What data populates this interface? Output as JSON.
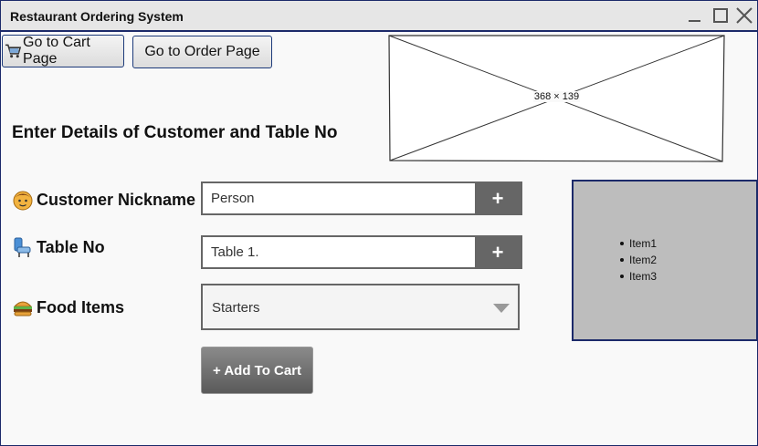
{
  "window": {
    "title": "Restaurant Ordering System"
  },
  "toolbar": {
    "cart_button_label": "Go to Cart Page",
    "order_button_label": "Go to Order Page"
  },
  "image_placeholder": {
    "label": "368 × 139"
  },
  "form": {
    "heading": "Enter Details of Customer and Table No",
    "nickname": {
      "label": "Customer Nickname",
      "value": "Person",
      "add_label": "+",
      "icon": "face-icon"
    },
    "table": {
      "label": "Table No",
      "value": "Table 1.",
      "add_label": "+",
      "icon": "seat-icon"
    },
    "food": {
      "label": "Food Items",
      "selected": "Starters",
      "icon": "burger-icon"
    },
    "add_to_cart_label": "+ Add To Cart"
  },
  "list_panel": {
    "items": [
      "Item1",
      "Item2",
      "Item3"
    ]
  },
  "colors": {
    "border_accent": "#1c2a6a",
    "button_dark": "#666666",
    "panel_bg": "#bdbdbd"
  }
}
